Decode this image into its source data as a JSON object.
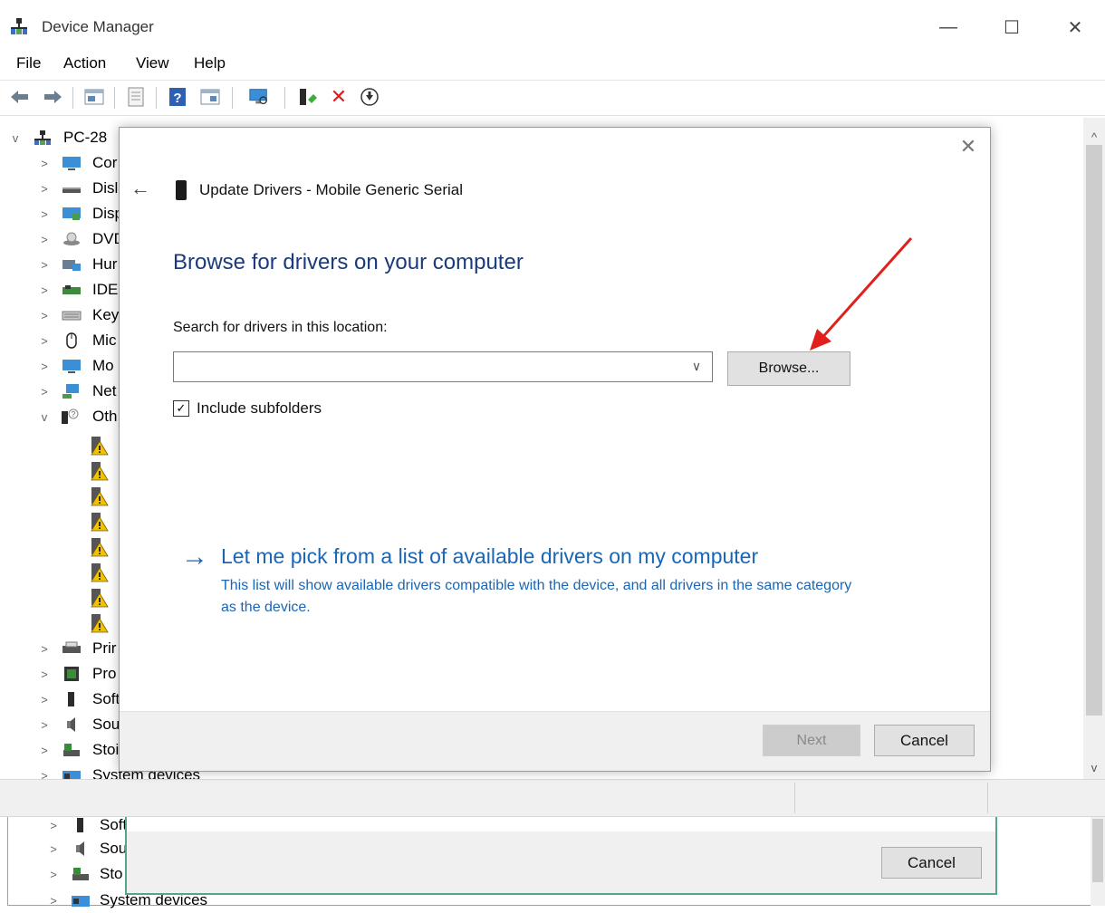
{
  "window": {
    "title": "Device Manager",
    "minimize_glyph": "—",
    "maximize_glyph": "☐",
    "close_glyph": "✕"
  },
  "menu": [
    {
      "label": "File"
    },
    {
      "label": "Action"
    },
    {
      "label": "View"
    },
    {
      "label": "Help"
    }
  ],
  "toolbar": {
    "icons": [
      "back-arrow-icon",
      "forward-arrow-icon",
      "properties-icon",
      "update-driver-icon",
      "help-icon",
      "view-icon",
      "scan-hardware-icon",
      "add-driver-icon",
      "uninstall-icon",
      "disable-icon"
    ],
    "delete_glyph": "✕"
  },
  "tree": {
    "root": {
      "label": "PC-28",
      "chevron": "v"
    },
    "items": [
      {
        "label": "Cor",
        "chevron": ">",
        "icon": "monitor-icon"
      },
      {
        "label": "Disl",
        "chevron": ">",
        "icon": "disk-icon"
      },
      {
        "label": "Disp",
        "chevron": ">",
        "icon": "display-adapter-icon"
      },
      {
        "label": "DVD",
        "chevron": ">",
        "icon": "dvd-icon"
      },
      {
        "label": "Hur",
        "chevron": ">",
        "icon": "hid-icon"
      },
      {
        "label": "IDE",
        "chevron": ">",
        "icon": "ide-icon"
      },
      {
        "label": "Key",
        "chevron": ">",
        "icon": "keyboard-icon"
      },
      {
        "label": "Mic",
        "chevron": ">",
        "icon": "mouse-icon"
      },
      {
        "label": "Mo",
        "chevron": ">",
        "icon": "monitor-icon"
      },
      {
        "label": "Net",
        "chevron": ">",
        "icon": "network-icon"
      },
      {
        "label": "Oth",
        "chevron": "v",
        "icon": "other-devices-icon"
      }
    ],
    "warning_children_count": 8,
    "items_after": [
      {
        "label": "Prir",
        "chevron": ">",
        "icon": "printer-icon"
      },
      {
        "label": "Pro",
        "chevron": ">",
        "icon": "processor-icon"
      },
      {
        "label": "Soft",
        "chevron": ">",
        "icon": "software-icon"
      },
      {
        "label": "Sou",
        "chevron": ">",
        "icon": "sound-icon"
      },
      {
        "label": "Stoi",
        "chevron": ">",
        "icon": "storage-icon"
      },
      {
        "label": "System devices",
        "chevron": ">",
        "icon": "system-devices-icon"
      }
    ]
  },
  "scrollbar": {
    "up": "^",
    "down": "v"
  },
  "dialog": {
    "close_glyph": "✕",
    "back_glyph": "←",
    "title": "Update Drivers - Mobile Generic Serial",
    "heading": "Browse for drivers on your computer",
    "search_label": "Search for drivers in this location:",
    "path_value": "",
    "combo_arrow": "∨",
    "browse_label": "Browse...",
    "include_subfolders_label": "Include subfolders",
    "include_subfolders_checked": "☑",
    "pick_arrow": "→",
    "pick_link": "Let me pick from a list of available drivers on my computer",
    "pick_desc": "This list will show available drivers compatible with the device, and all drivers in the same category as the device.",
    "next_label": "Next",
    "cancel_label": "Cancel"
  },
  "background_window": {
    "items": [
      {
        "label": "Soft",
        "chevron": ">",
        "icon": "software-icon"
      },
      {
        "label": "Sou",
        "chevron": ">",
        "icon": "sound-icon"
      },
      {
        "label": "Sto",
        "chevron": ">",
        "icon": "storage-icon"
      },
      {
        "label": "System devices",
        "chevron": ">",
        "icon": "system-devices-icon"
      }
    ],
    "cancel_label": "Cancel"
  },
  "colors": {
    "accent_link": "#1a66b5",
    "heading": "#1a3b7a",
    "annotation": "#e0201b",
    "warning": "#f2c200"
  }
}
